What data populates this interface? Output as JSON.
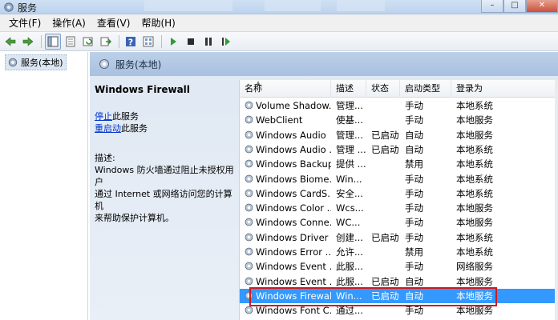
{
  "window": {
    "title": "服务"
  },
  "menu": [
    "文件(F)",
    "操作(A)",
    "查看(V)",
    "帮助(H)"
  ],
  "toolbar": {
    "icons": [
      "back-icon",
      "forward-icon",
      "console-tree-icon",
      "properties-icon",
      "refresh-icon",
      "export-icon",
      "help-icon",
      "view-icon",
      "play-icon",
      "stop-icon",
      "pause-icon",
      "restart-icon"
    ]
  },
  "tree": {
    "root": "服务(本地)"
  },
  "header": {
    "title": "服务(本地)"
  },
  "details": {
    "service_name": "Windows Firewall",
    "stop_link": "停止",
    "stop_suffix": "此服务",
    "restart_link": "重启动",
    "restart_suffix": "此服务",
    "desc_label": "描述:",
    "desc_lines": [
      "Windows 防火墙通过阻止未授权用户",
      "通过 Internet 或网络访问您的计算机",
      "来帮助保护计算机。"
    ]
  },
  "table": {
    "columns": [
      "名称",
      "描述",
      "状态",
      "启动类型",
      "登录为"
    ],
    "rows": [
      {
        "name": "Volume Shadow...",
        "desc": "管理...",
        "status": "",
        "startup": "手动",
        "logon": "本地系统"
      },
      {
        "name": "WebClient",
        "desc": "使基...",
        "status": "",
        "startup": "手动",
        "logon": "本地服务"
      },
      {
        "name": "Windows Audio",
        "desc": "管理...",
        "status": "已启动",
        "startup": "自动",
        "logon": "本地服务"
      },
      {
        "name": "Windows Audio ...",
        "desc": "管理 ...",
        "status": "已启动",
        "startup": "自动",
        "logon": "本地系统"
      },
      {
        "name": "Windows Backup",
        "desc": "提供 ...",
        "status": "",
        "startup": "禁用",
        "logon": "本地系统"
      },
      {
        "name": "Windows Biome...",
        "desc": "Win...",
        "status": "",
        "startup": "手动",
        "logon": "本地系统"
      },
      {
        "name": "Windows CardS...",
        "desc": "安全...",
        "status": "",
        "startup": "手动",
        "logon": "本地系统"
      },
      {
        "name": "Windows Color ...",
        "desc": "Wcs...",
        "status": "",
        "startup": "手动",
        "logon": "本地服务"
      },
      {
        "name": "Windows Conne...",
        "desc": "WC...",
        "status": "",
        "startup": "手动",
        "logon": "本地服务"
      },
      {
        "name": "Windows Driver ...",
        "desc": "创建...",
        "status": "已启动",
        "startup": "手动",
        "logon": "本地系统"
      },
      {
        "name": "Windows Error ...",
        "desc": "允许...",
        "status": "",
        "startup": "禁用",
        "logon": "本地系统"
      },
      {
        "name": "Windows Event ...",
        "desc": "此服...",
        "status": "",
        "startup": "手动",
        "logon": "网络服务"
      },
      {
        "name": "Windows Event ...",
        "desc": "此服...",
        "status": "已启动",
        "startup": "自动",
        "logon": "本地服务"
      },
      {
        "name": "Windows Firewall",
        "desc": "Win...",
        "status": "已启动",
        "startup": "自动",
        "logon": "本地服务"
      },
      {
        "name": "Windows Font C...",
        "desc": "通过...",
        "status": "",
        "startup": "手动",
        "logon": "本地服务"
      }
    ],
    "selected_index": 13
  },
  "colors": {
    "selection": "#3399ff",
    "highlight_border": "#d21919",
    "link": "#0033cc"
  }
}
